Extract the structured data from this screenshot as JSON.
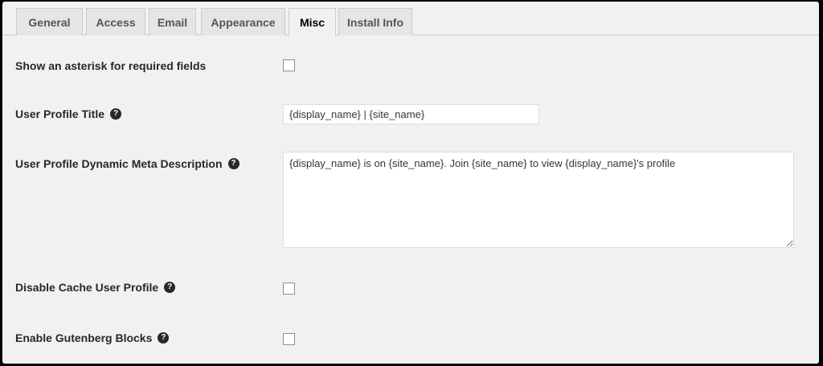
{
  "tabs": [
    {
      "label": "General",
      "active": false
    },
    {
      "label": "Access",
      "active": false
    },
    {
      "label": "Email",
      "active": false
    },
    {
      "label": "Appearance",
      "active": false
    },
    {
      "label": "Misc",
      "active": true
    },
    {
      "label": "Install Info",
      "active": false
    }
  ],
  "settings": {
    "asterisk": {
      "label": "Show an asterisk for required fields",
      "checked": false
    },
    "profile_title": {
      "label": "User Profile Title",
      "value": "{display_name} | {site_name}"
    },
    "meta_description": {
      "label": "User Profile Dynamic Meta Description",
      "value": "{display_name} is on {site_name}. Join {site_name} to view {display_name}'s profile"
    },
    "disable_cache": {
      "label": "Disable Cache User Profile",
      "checked": false
    },
    "gutenberg": {
      "label": "Enable Gutenberg Blocks",
      "checked": false
    }
  },
  "icons": {
    "help": "?"
  },
  "colors": {
    "background": "#f1f1f1",
    "tab_inactive": "#e5e5e5",
    "label_text": "#23282d",
    "frame": "#000000"
  }
}
